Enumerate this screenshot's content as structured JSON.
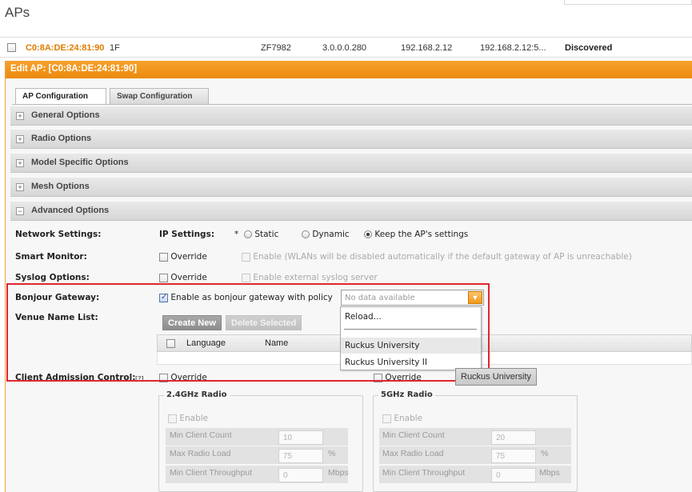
{
  "page": {
    "title": "APs"
  },
  "ap_row": {
    "mac": "C0:8A:DE:24:81:90",
    "name": "1F",
    "model": "ZF7982",
    "version": "3.0.0.0.280",
    "ip": "192.168.2.12",
    "ipv6": "192.168.2.12:5...",
    "status": "Discovered"
  },
  "edit_panel": {
    "header": "Edit AP: [C0:8A:DE:24:81:90]",
    "tabs": [
      {
        "label": "AP Configuration"
      },
      {
        "label": "Swap Configuration"
      }
    ],
    "sections": [
      {
        "label": "General Options",
        "expander": "+"
      },
      {
        "label": "Radio Options",
        "expander": "+"
      },
      {
        "label": "Model Specific Options",
        "expander": "+"
      },
      {
        "label": "Mesh Options",
        "expander": "+"
      },
      {
        "label": "Advanced Options",
        "expander": "−"
      }
    ]
  },
  "advanced": {
    "network_label": "Network Settings:",
    "ip_label": "IP Settings:",
    "ip_asterisk": "*",
    "ip_options": [
      "Static",
      "Dynamic",
      "Keep the AP's settings"
    ],
    "smart_label": "Smart Monitor:",
    "smart_override": "Override",
    "smart_enable": "Enable (WLANs will be disabled automatically if the default gateway of AP is unreachable)",
    "syslog_label": "Syslog Options:",
    "syslog_override": "Override",
    "syslog_enable": "Enable external syslog server",
    "bonjour_label": "Bonjour Gateway:",
    "bonjour_check": "Enable as bonjour gateway with policy",
    "combo_placeholder": "No data available",
    "dropdown_items": [
      "Reload...",
      "Ruckus University",
      "Ruckus University II"
    ],
    "venue_label": "Venue Name List:",
    "create_new": "Create New",
    "delete_selected": "Delete Selected",
    "col_language": "Language",
    "col_name": "Name",
    "cac_label": "Client Admission Control:",
    "cac_help": "[?]",
    "cac_override": "Override",
    "cac_override_5g": "Override",
    "tooltip": "Ruckus University",
    "radio24": {
      "title": "2.4GHz Radio",
      "enable": "Enable",
      "min_client_label": "Min Client Count",
      "min_client_value": "10",
      "max_load_label": "Max Radio Load",
      "max_load_value": "75",
      "max_load_unit": "%",
      "min_tp_label": "Min Client Throughput",
      "min_tp_value": "0",
      "min_tp_unit": "Mbps"
    },
    "radio5": {
      "title": "5GHz Radio",
      "enable": "Enable",
      "min_client_label": "Min Client Count",
      "min_client_value": "20",
      "max_load_label": "Max Radio Load",
      "max_load_value": "75",
      "max_load_unit": "%",
      "min_tp_label": "Min Client Throughput",
      "min_tp_value": "0",
      "min_tp_unit": "Mbps"
    }
  }
}
